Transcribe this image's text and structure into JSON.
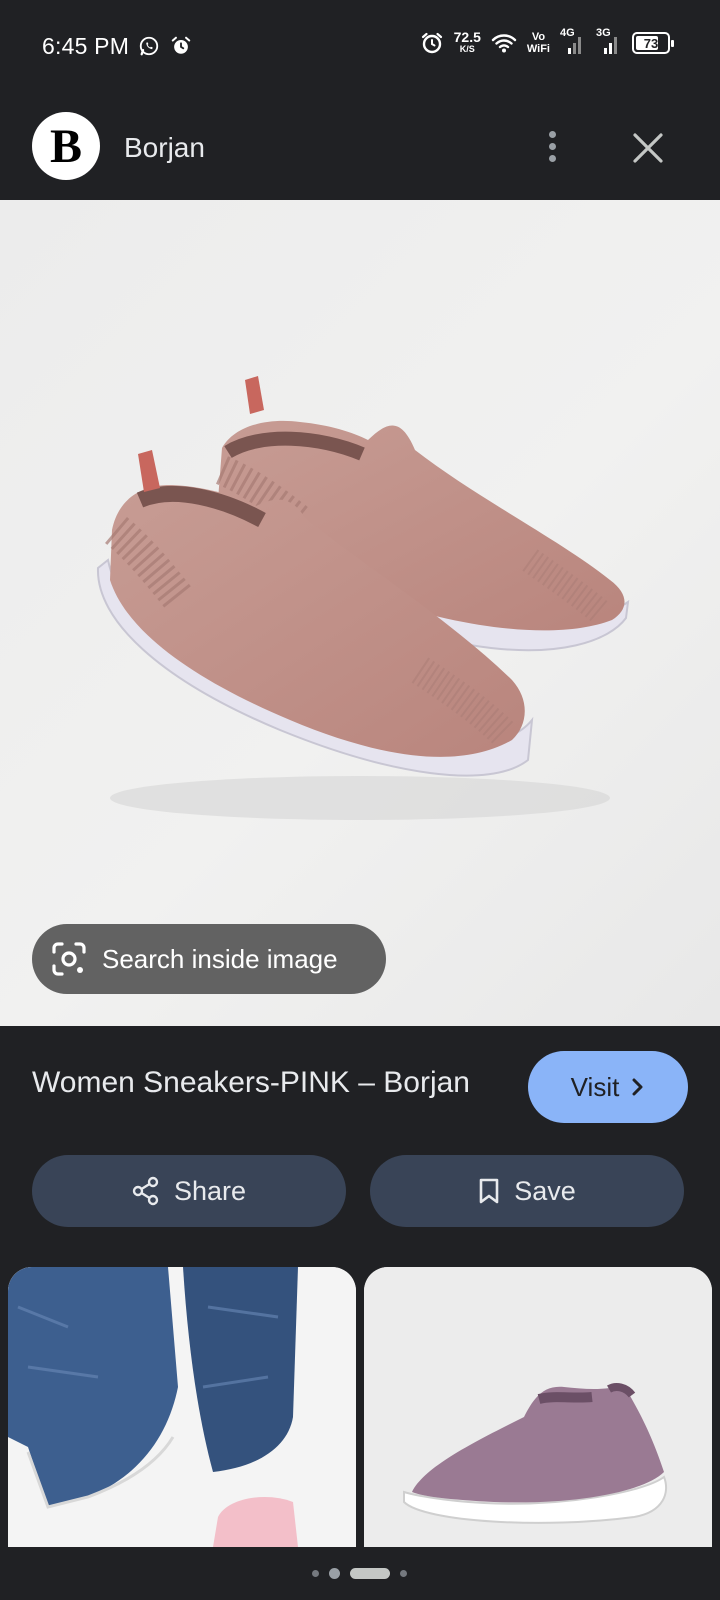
{
  "status_bar": {
    "time": "6:45 PM",
    "speed_value": "72.5",
    "speed_unit": "K/S",
    "volte_line1": "Vo",
    "volte_line2": "WiFi",
    "net1": "4G",
    "net2": "3G",
    "battery_percent": "73",
    "battery_level": 0.73
  },
  "header": {
    "site_logo_letter": "B",
    "site_name": "Borjan"
  },
  "image_view": {
    "search_inside_label": "Search inside image",
    "product_color": "#c59a92",
    "sole_color": "#e6e4ef"
  },
  "result": {
    "title": "Women Sneakers-PINK – Borjan",
    "visit_label": "Visit"
  },
  "actions": {
    "share_label": "Share",
    "save_label": "Save"
  },
  "colors": {
    "background": "#202124",
    "accent": "#8ab4f8",
    "pill": "#394457",
    "lens_pill": "#626262"
  }
}
